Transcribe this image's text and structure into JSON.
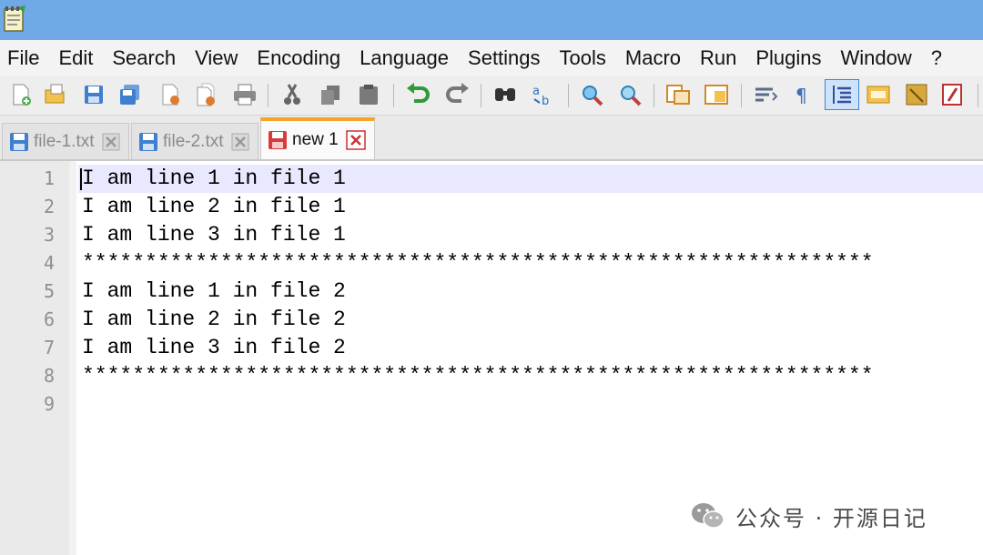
{
  "window": {
    "app_icon": "notepad-plus-icon"
  },
  "menu": {
    "items": [
      "File",
      "Edit",
      "Search",
      "View",
      "Encoding",
      "Language",
      "Settings",
      "Tools",
      "Macro",
      "Run",
      "Plugins",
      "Window",
      "?"
    ]
  },
  "toolbar": {
    "buttons": [
      "new-file-icon",
      "open-file-icon",
      "save-icon",
      "save-all-icon",
      "close-icon",
      "close-all-icon",
      "print-icon",
      "cut-icon",
      "copy-icon",
      "paste-icon",
      "undo-icon",
      "redo-icon",
      "find-icon",
      "replace-icon",
      "zoom-in-icon",
      "zoom-out-icon",
      "sync-vertical-icon",
      "sync-horizontal-icon",
      "word-wrap-icon",
      "show-all-chars-icon",
      "indent-guide-icon",
      "doc-map-icon",
      "function-list-icon",
      "record-macro-icon"
    ]
  },
  "tabs": [
    {
      "label": "file-1.txt",
      "active": false,
      "icon": "saved-file-icon"
    },
    {
      "label": "file-2.txt",
      "active": false,
      "icon": "saved-file-icon"
    },
    {
      "label": "new 1",
      "active": true,
      "icon": "unsaved-file-icon"
    }
  ],
  "editor": {
    "current_line": 1,
    "lines": [
      {
        "number": "1",
        "text": "I am line 1 in file 1"
      },
      {
        "number": "2",
        "text": "I am line 2 in file 1"
      },
      {
        "number": "3",
        "text": "I am line 3 in file 1"
      },
      {
        "number": "4",
        "text": "***************************************************************"
      },
      {
        "number": "5",
        "text": "I am line 1 in file 2"
      },
      {
        "number": "6",
        "text": "I am line 2 in file 2"
      },
      {
        "number": "7",
        "text": "I am line 3 in file 2"
      },
      {
        "number": "8",
        "text": "***************************************************************"
      },
      {
        "number": "9",
        "text": ""
      }
    ]
  },
  "watermark": {
    "text": "公众号 · 开源日记",
    "icon": "wechat-icon"
  },
  "colors": {
    "titlebar": "#6fa9e6",
    "active_tab_accent": "#f4a52b",
    "current_line": "#e8e8ff"
  }
}
